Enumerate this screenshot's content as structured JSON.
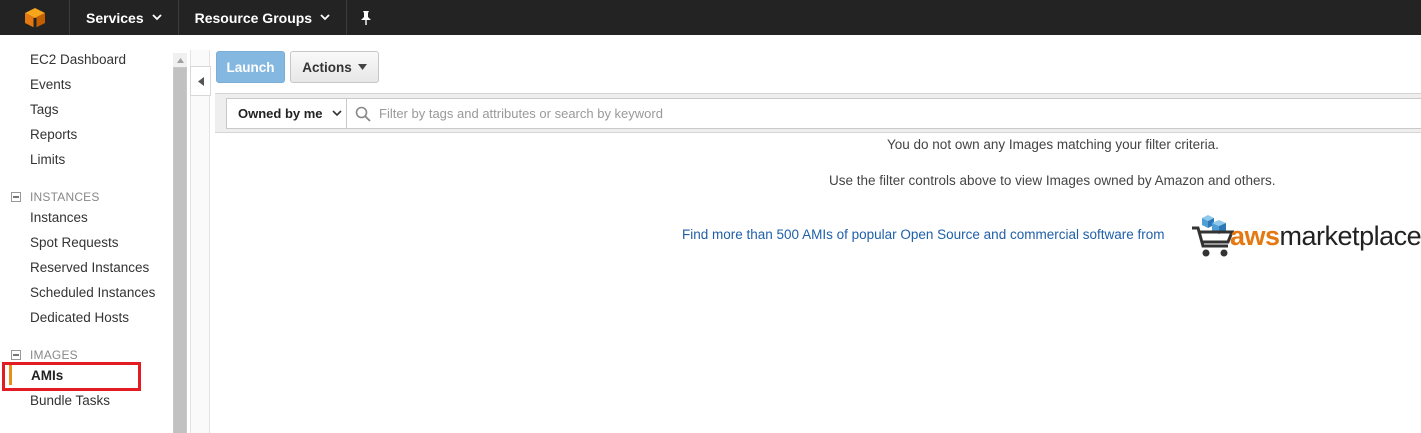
{
  "topnav": {
    "logo_icon": "aws-cube-icon",
    "services_label": "Services",
    "resource_groups_label": "Resource Groups",
    "pin_icon": "pin-icon"
  },
  "sidebar": {
    "top_links": [
      {
        "label": "EC2 Dashboard"
      },
      {
        "label": "Events"
      },
      {
        "label": "Tags"
      },
      {
        "label": "Reports"
      },
      {
        "label": "Limits"
      }
    ],
    "instances_section": {
      "title": "INSTANCES",
      "links": [
        {
          "label": "Instances"
        },
        {
          "label": "Spot Requests"
        },
        {
          "label": "Reserved Instances"
        },
        {
          "label": "Scheduled Instances"
        },
        {
          "label": "Dedicated Hosts"
        }
      ]
    },
    "images_section": {
      "title": "IMAGES",
      "links": [
        {
          "label": "AMIs",
          "active": true
        },
        {
          "label": "Bundle Tasks"
        }
      ]
    }
  },
  "toolbar": {
    "launch_label": "Launch",
    "actions_label": "Actions"
  },
  "filter": {
    "owner_selected": "Owned by me",
    "search_placeholder": "Filter by tags and attributes or search by keyword"
  },
  "content": {
    "empty_message": "You do not own any Images matching your filter criteria.",
    "hint_message": "Use the filter controls above to view Images owned by Amazon and others.",
    "marketplace_link": "Find more than 500 AMIs of popular Open Source and commercial software from",
    "marketplace_logo_aws": "aws",
    "marketplace_logo_rest": "marketplace"
  },
  "colors": {
    "topnav_bg": "#232323",
    "launch_bg": "#85b8e0",
    "active_indicator": "#e88e1d",
    "highlight": "#e31b23",
    "link": "#1f5fa8",
    "aws_orange": "#e47911"
  }
}
